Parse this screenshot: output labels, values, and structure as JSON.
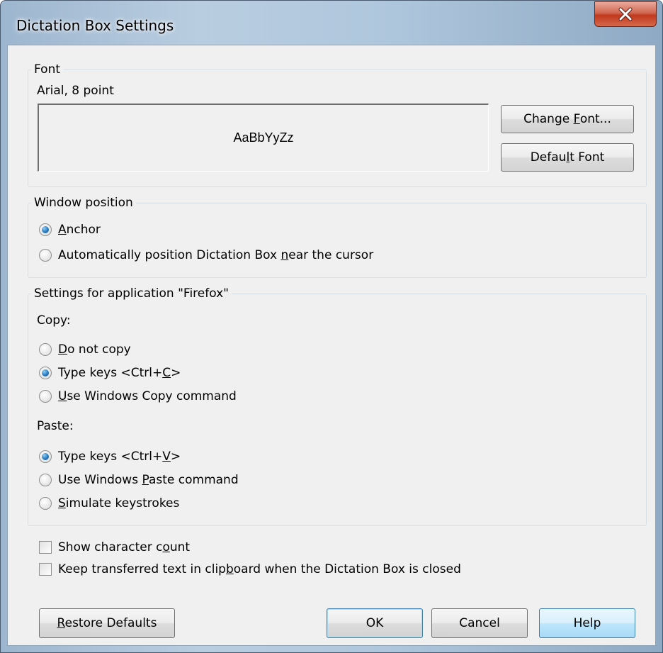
{
  "window": {
    "title": "Dictation Box Settings"
  },
  "font_group": {
    "legend": "Font",
    "current_font": "Arial, 8 point",
    "preview_text": "AaBbYyZz",
    "change_font_button": {
      "pre": "Change ",
      "key": "F",
      "post": "ont..."
    },
    "default_font_button": {
      "pre": "Defau",
      "key": "l",
      "post": "t Font"
    }
  },
  "window_position": {
    "legend": "Window position",
    "options": [
      {
        "pre": "",
        "key": "A",
        "post": "nchor",
        "selected": true
      },
      {
        "pre": "Automatically position Dictation Box ",
        "key": "n",
        "post": "ear the cursor",
        "selected": false
      }
    ]
  },
  "app_settings": {
    "legend": "Settings for application \"Firefox\"",
    "copy_label": "Copy:",
    "copy_options": [
      {
        "pre": "",
        "key": "D",
        "post": "o not copy",
        "selected": false
      },
      {
        "pre": "Type keys <Ctrl+",
        "key": "C",
        "post": ">",
        "selected": true
      },
      {
        "pre": "",
        "key": "U",
        "post": "se Windows Copy command",
        "selected": false
      }
    ],
    "paste_label": "Paste:",
    "paste_options": [
      {
        "pre": "Type keys <Ctrl+",
        "key": "V",
        "post": ">",
        "selected": true
      },
      {
        "pre": "Use Windows ",
        "key": "P",
        "post": "aste command",
        "selected": false
      },
      {
        "pre": "",
        "key": "S",
        "post": "imulate keystrokes",
        "selected": false
      }
    ]
  },
  "checkboxes": [
    {
      "pre": "Show character c",
      "key": "o",
      "post": "unt",
      "checked": false
    },
    {
      "pre": "Keep transferred text in clip",
      "key": "b",
      "post": "oard when the Dictation Box is closed",
      "checked": false
    }
  ],
  "buttons": {
    "restore": {
      "pre": "",
      "key": "R",
      "post": "estore Defaults"
    },
    "ok": "OK",
    "cancel": "Cancel",
    "help": "Help"
  }
}
